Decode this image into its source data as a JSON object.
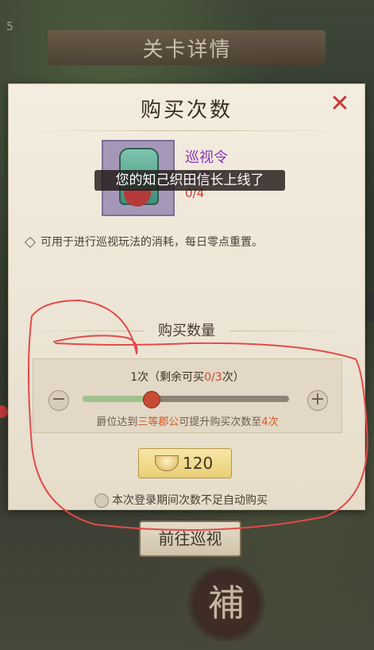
{
  "background": {
    "corner_number": "5",
    "top_title": "关卡详情",
    "lower_button": "前往巡视",
    "seal_text": "補"
  },
  "dialog": {
    "title": "购买次数",
    "close_icon": "close-x-icon"
  },
  "item": {
    "icon": "patrol-token-icon",
    "name": "巡视令",
    "quality": "紫品",
    "count": "0/4"
  },
  "toast": {
    "text": "您的知己织田信长上线了"
  },
  "description": "可用于进行巡视玩法的消耗，每日零点重置。",
  "quantity_section": {
    "title": "购买数量",
    "count_prefix": "1次（剩余可买",
    "remaining": "0/3",
    "count_suffix": "次）",
    "minus_label": "−",
    "plus_label": "+",
    "slider_level": 0.33,
    "hint_prefix": "爵位达到",
    "hint_rank": "三等郡公",
    "hint_middle": "可提升购买次数至",
    "hint_number": "4次"
  },
  "buy_button": {
    "icon": "gold-ingot-icon",
    "price": "120"
  },
  "auto_purchase": {
    "label": "本次登录期间次数不足自动购买"
  },
  "colors": {
    "accent_red": "#c43a32",
    "purple_item": "#8a35b8",
    "highlight_orange": "#d05a2a",
    "slider_green": "#9fc08d"
  }
}
